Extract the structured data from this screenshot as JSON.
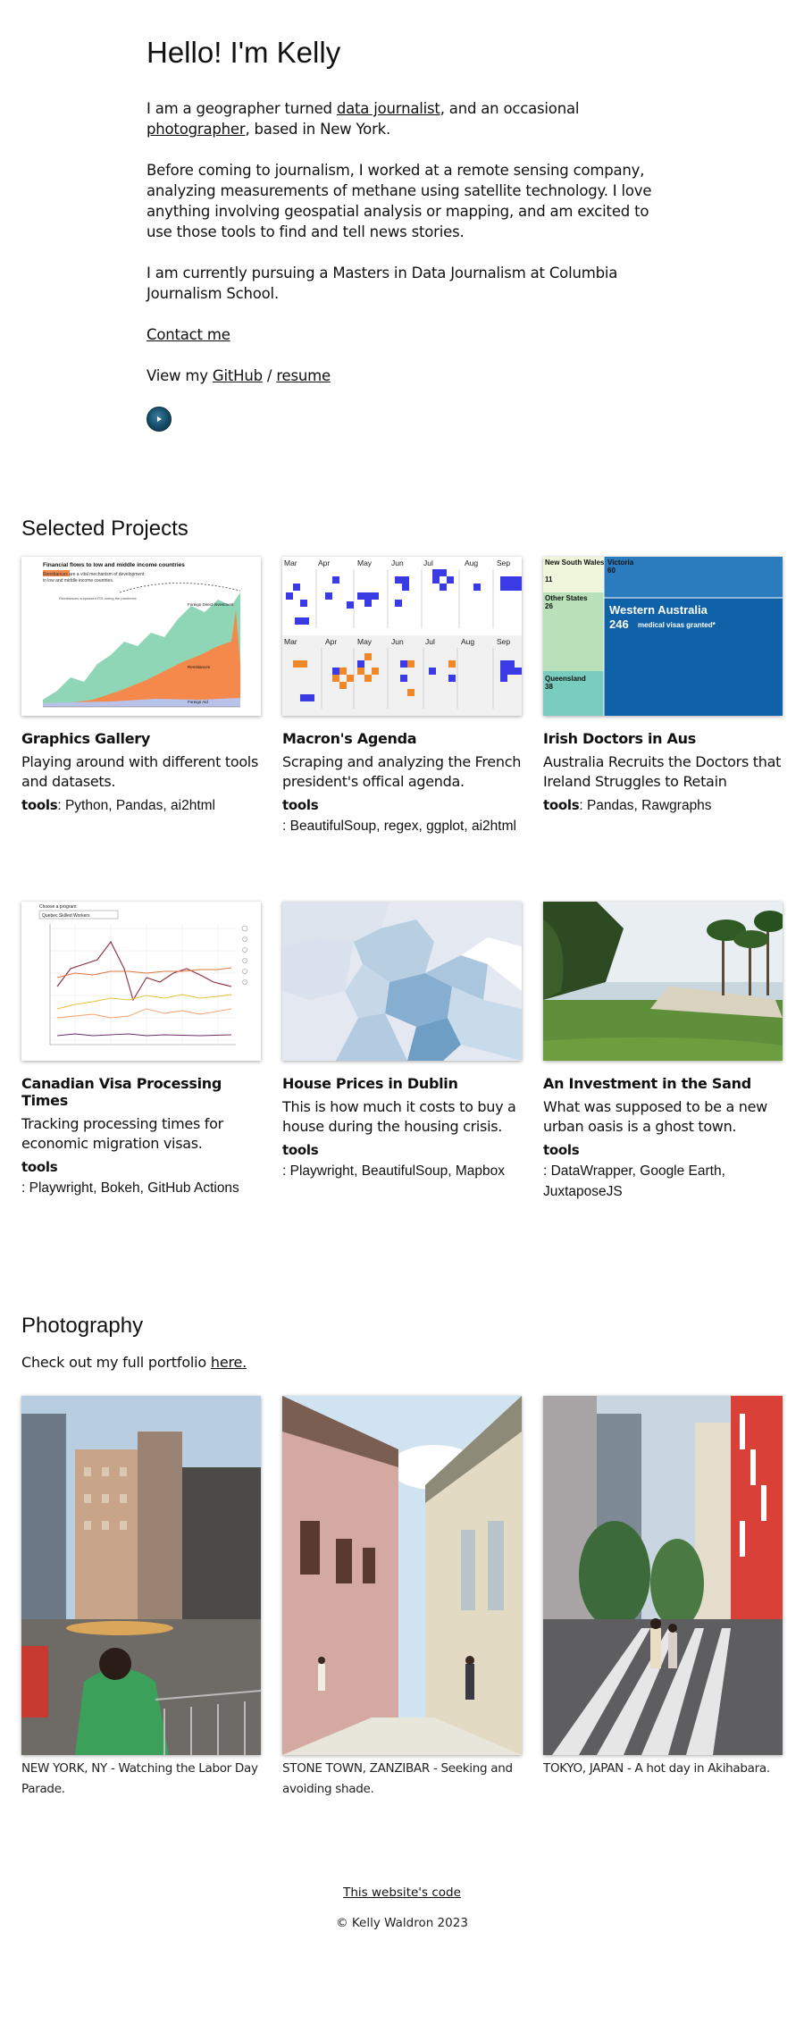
{
  "intro": {
    "heading": "Hello! I'm Kelly",
    "p1_a": "I am a geographer turned ",
    "p1_link1": "data journalist",
    "p1_b": ", and an occasional ",
    "p1_link2": "photographer",
    "p1_c": ", based in New York.",
    "p2": "Before coming to journalism, I worked at a remote sensing company, analyzing measurements of methane using satellite technology. I love anything involving geospatial analysis or mapping, and am excited to use those tools to find and tell news stories.",
    "p3": "I am currently pursuing a Masters in Data Journalism at Columbia Journalism School.",
    "contact": "Contact me",
    "view_prefix": "View my ",
    "github": "GitHub",
    "sep": " / ",
    "resume": "resume"
  },
  "projects": {
    "title": "Selected Projects",
    "items": [
      {
        "title": "Graphics Gallery",
        "desc": "Playing around with different tools and datasets.",
        "tools_label": "tools",
        "tools": ": Python, Pandas, ai2html"
      },
      {
        "title": "Macron's Agenda",
        "desc": "Scraping and analyzing the French president's offical agenda.",
        "tools_label": "tools",
        "tools": ": BeautifulSoup, regex, ggplot, ai2html"
      },
      {
        "title": "Irish Doctors in Aus",
        "desc": "Australia Recruits the Doctors that Ireland Struggles to Retain",
        "tools_label": "tools",
        "tools": ": Pandas, Rawgraphs"
      },
      {
        "title": "Canadian Visa Processing Times",
        "desc": "Tracking processing times for economic migration visas.",
        "tools_label": "tools",
        "tools": ": Playwright, Bokeh, GitHub Actions"
      },
      {
        "title": "House Prices in Dublin",
        "desc": "This is how much it costs to buy a house during the housing crisis.",
        "tools_label": "tools",
        "tools": ": Playwright, BeautifulSoup, Mapbox"
      },
      {
        "title": "An Investment in the Sand",
        "desc": "What was supposed to be a new urban oasis is a ghost town.",
        "tools_label": "tools",
        "tools": ": DataWrapper, Google Earth, JuxtaposeJS"
      }
    ],
    "thumbs": {
      "gallery_title": "Financial flows to low and middle income countries",
      "gallery_sub1": "Remittances are a vital mechanism of development",
      "gallery_sub2": "in low and middle income countries.",
      "gallery_note": "Remittances surpassed FDI during the pandemic",
      "gallery_fdi": "Foreign Direct Investment",
      "gallery_rem": "Remittances",
      "gallery_aid": "Foreign Aid",
      "months": [
        "Mar",
        "Apr",
        "May",
        "Jun",
        "Jul",
        "Aug",
        "Sep"
      ],
      "tree_nsw": "New South Wales",
      "tree_nsw_v": "11",
      "tree_vic": "Victoria",
      "tree_vic_v": "60",
      "tree_other": "Other States",
      "tree_other_v": "26",
      "tree_qld": "Queensland",
      "tree_qld_v": "38",
      "tree_wa": "Western Australia",
      "tree_wa_v": "246",
      "tree_wa_sub": "medical visas granted*",
      "visa_choose": "Choose a program:",
      "visa_select": "Quebec Skilled Workers"
    }
  },
  "photography": {
    "title": "Photography",
    "intro_a": "Check out my full portfolio ",
    "intro_link": "here.",
    "items": [
      {
        "caption": "NEW YORK, NY - Watching the Labor Day Parade."
      },
      {
        "caption": "STONE TOWN, ZANZIBAR - Seeking and avoiding shade."
      },
      {
        "caption": "TOKYO, JAPAN - A hot day in Akihabara."
      }
    ]
  },
  "footer": {
    "code_link": "This website's code",
    "copyright": "© Kelly Waldron 2023"
  },
  "colors": {
    "accent_blue": "#1f6fb5",
    "remittance_orange": "#f4894b",
    "fdi_green": "#8fd6b6",
    "square_blue": "#3b3be6",
    "square_orange": "#f0882a"
  }
}
